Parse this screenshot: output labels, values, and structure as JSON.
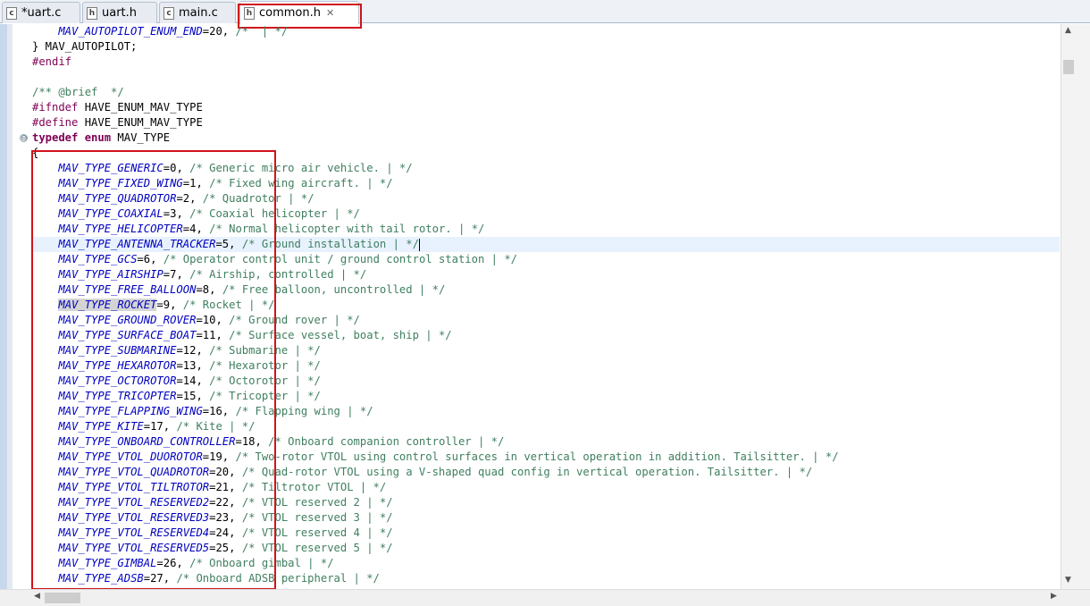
{
  "tabs": [
    {
      "label": "*uart.c",
      "icon": "c-file-icon",
      "icon_glyph": "c"
    },
    {
      "label": "uart.h",
      "icon": "h-file-icon",
      "icon_glyph": "h"
    },
    {
      "label": "main.c",
      "icon": "c-file-icon",
      "icon_glyph": "c"
    },
    {
      "label": "common.h",
      "icon": "h-file-icon",
      "icon_glyph": "h",
      "active": true,
      "close": "✕"
    }
  ],
  "highlight_color": "#d0131b",
  "code": {
    "top_lines": {
      "l0_name": "    MAV_AUTOPILOT_ENUM_END",
      "l0_rest": "=20, ",
      "l0_cm": "/*  | */",
      "l1": "} MAV_AUTOPILOT;",
      "l2": "#endif",
      "l4": "/** @brief  */",
      "l5_kw": "#ifndef",
      "l5_rest": " HAVE_ENUM_MAV_TYPE",
      "l6_kw": "#define",
      "l6_rest": " HAVE_ENUM_MAV_TYPE",
      "l7_kw1": "typedef",
      "l7_kw2": "enum",
      "l7_rest": " MAV_TYPE",
      "l8": "{"
    },
    "enum_items": [
      {
        "name": "MAV_TYPE_GENERIC",
        "value": "=0, ",
        "comment": "/* Generic micro air vehicle. | */"
      },
      {
        "name": "MAV_TYPE_FIXED_WING",
        "value": "=1, ",
        "comment": "/* Fixed wing aircraft. | */"
      },
      {
        "name": "MAV_TYPE_QUADROTOR",
        "value": "=2, ",
        "comment": "/* Quadrotor | */"
      },
      {
        "name": "MAV_TYPE_COAXIAL",
        "value": "=3, ",
        "comment": "/* Coaxial helicopter | */"
      },
      {
        "name": "MAV_TYPE_HELICOPTER",
        "value": "=4, ",
        "comment": "/* Normal helicopter with tail rotor. | */"
      },
      {
        "name": "MAV_TYPE_ANTENNA_TRACKER",
        "value": "=5, ",
        "comment": "/* Ground installation | */"
      },
      {
        "name": "MAV_TYPE_GCS",
        "value": "=6, ",
        "comment": "/* Operator control unit / ground control station | */"
      },
      {
        "name": "MAV_TYPE_AIRSHIP",
        "value": "=7, ",
        "comment": "/* Airship, controlled | */"
      },
      {
        "name": "MAV_TYPE_FREE_BALLOON",
        "value": "=8, ",
        "comment": "/* Free balloon, uncontrolled | */"
      },
      {
        "name": "MAV_TYPE_ROCKET",
        "value": "=9, ",
        "comment": "/* Rocket | */"
      },
      {
        "name": "MAV_TYPE_GROUND_ROVER",
        "value": "=10, ",
        "comment": "/* Ground rover | */"
      },
      {
        "name": "MAV_TYPE_SURFACE_BOAT",
        "value": "=11, ",
        "comment": "/* Surface vessel, boat, ship | */"
      },
      {
        "name": "MAV_TYPE_SUBMARINE",
        "value": "=12, ",
        "comment": "/* Submarine | */"
      },
      {
        "name": "MAV_TYPE_HEXAROTOR",
        "value": "=13, ",
        "comment": "/* Hexarotor | */"
      },
      {
        "name": "MAV_TYPE_OCTOROTOR",
        "value": "=14, ",
        "comment": "/* Octorotor | */"
      },
      {
        "name": "MAV_TYPE_TRICOPTER",
        "value": "=15, ",
        "comment": "/* Tricopter | */"
      },
      {
        "name": "MAV_TYPE_FLAPPING_WING",
        "value": "=16, ",
        "comment": "/* Flapping wing | */"
      },
      {
        "name": "MAV_TYPE_KITE",
        "value": "=17, ",
        "comment": "/* Kite | */"
      },
      {
        "name": "MAV_TYPE_ONBOARD_CONTROLLER",
        "value": "=18, ",
        "comment": "/* Onboard companion controller | */"
      },
      {
        "name": "MAV_TYPE_VTOL_DUOROTOR",
        "value": "=19, ",
        "comment": "/* Two-rotor VTOL using control surfaces in vertical operation in addition. Tailsitter. | */"
      },
      {
        "name": "MAV_TYPE_VTOL_QUADROTOR",
        "value": "=20, ",
        "comment": "/* Quad-rotor VTOL using a V-shaped quad config in vertical operation. Tailsitter. | */"
      },
      {
        "name": "MAV_TYPE_VTOL_TILTROTOR",
        "value": "=21, ",
        "comment": "/* Tiltrotor VTOL | */"
      },
      {
        "name": "MAV_TYPE_VTOL_RESERVED2",
        "value": "=22, ",
        "comment": "/* VTOL reserved 2 | */"
      },
      {
        "name": "MAV_TYPE_VTOL_RESERVED3",
        "value": "=23, ",
        "comment": "/* VTOL reserved 3 | */"
      },
      {
        "name": "MAV_TYPE_VTOL_RESERVED4",
        "value": "=24, ",
        "comment": "/* VTOL reserved 4 | */"
      },
      {
        "name": "MAV_TYPE_VTOL_RESERVED5",
        "value": "=25, ",
        "comment": "/* VTOL reserved 5 | */"
      },
      {
        "name": "MAV_TYPE_GIMBAL",
        "value": "=26, ",
        "comment": "/* Onboard gimbal | */"
      },
      {
        "name": "MAV_TYPE_ADSB",
        "value": "=27, ",
        "comment": "/* Onboard ADSB peripheral | */"
      }
    ]
  },
  "icons": {
    "fold": "⊖",
    "scroll_up": "▲",
    "scroll_down": "▼",
    "scroll_left": "◀",
    "scroll_right": "▶"
  }
}
